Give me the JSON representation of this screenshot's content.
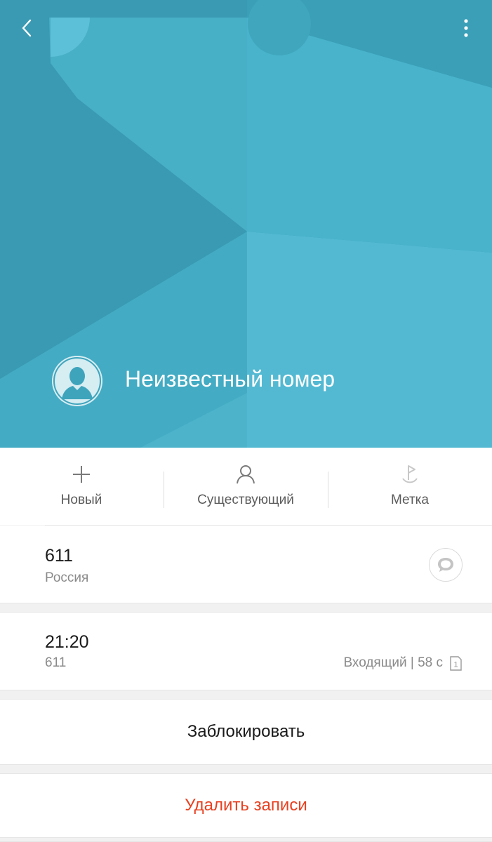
{
  "header": {
    "back_icon": "chevron-left-icon",
    "menu_icon": "more-vertical-icon",
    "contact_name": "Неизвестный номер",
    "avatar_icon": "person-silhouette-icon",
    "colors": {
      "hero": "#3a9db6",
      "hero_light": "#55bad4"
    }
  },
  "actions": [
    {
      "label": "Новый",
      "icon": "plus-icon"
    },
    {
      "label": "Существующий",
      "icon": "person-icon"
    },
    {
      "label": "Метка",
      "icon": "flag-icon"
    }
  ],
  "number_card": {
    "number": "611",
    "region": "Россия",
    "message_icon": "message-icon"
  },
  "call_log": {
    "time": "21:20",
    "number": "611",
    "type_duration": "Входящий | 58 с",
    "sim_label": "1"
  },
  "buttons": {
    "block": "Заблокировать",
    "delete": "Удалить записи",
    "delete_color": "#e8401f"
  }
}
